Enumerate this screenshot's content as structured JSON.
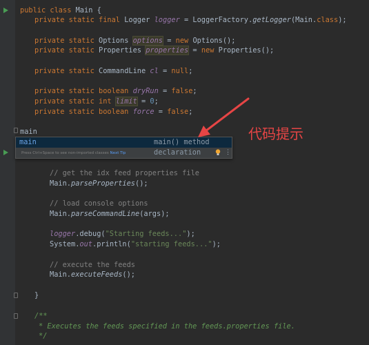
{
  "code": {
    "class_decl": {
      "kw": "public class ",
      "name": "Main {"
    },
    "logger": {
      "kw": "private static final ",
      "type": "Logger ",
      "field": "logger",
      "rest1": " = LoggerFactory.",
      "method": "getLogger",
      "rest2": "(Main.",
      "kw2": "class",
      "rest3": ");"
    },
    "options": {
      "kw": "private static ",
      "type": "Options ",
      "field": "options",
      "rest1": " = ",
      "kw2": "new ",
      "rest2": "Options();"
    },
    "properties": {
      "kw": "private static ",
      "type": "Properties ",
      "field": "properties",
      "rest1": " = ",
      "kw2": "new ",
      "rest2": "Properties();"
    },
    "cmdline": {
      "kw": "private static ",
      "type": "CommandLine ",
      "field": "cl",
      "rest1": " = ",
      "kw2": "null",
      "rest2": ";"
    },
    "dryrun": {
      "kw": "private static boolean ",
      "field": "dryRun",
      "rest1": " = ",
      "kw2": "false",
      "rest2": ";"
    },
    "limit": {
      "kw": "private static int ",
      "field": "limit",
      "rest1": " = ",
      "num": "0",
      "rest2": ";"
    },
    "force": {
      "kw": "private static boolean ",
      "field": "force",
      "rest1": " = ",
      "kw2": "false",
      "rest2": ";"
    },
    "typed": "main",
    "comment1": "// get the idx feed properties file",
    "call1": {
      "obj": "Main.",
      "method": "parseProperties",
      "rest": "();"
    },
    "comment2": "// load console options",
    "call2": {
      "obj": "Main.",
      "method": "parseCommandLine",
      "rest": "(args);"
    },
    "debug": {
      "field": "logger",
      "rest1": ".debug(",
      "str": "\"Starting feeds...\"",
      "rest2": ");"
    },
    "println": {
      "obj": "System.",
      "field": "out",
      "rest1": ".println(",
      "str": "\"starting feeds...\"",
      "rest2": ");"
    },
    "comment3": "// execute the feeds",
    "call3": {
      "obj": "Main.",
      "method": "executeFeeds",
      "rest": "();"
    },
    "close_brace": "}",
    "doc_open": "/**",
    "doc_body": "* Executes the feeds specified in the feeds.properties file.",
    "doc_close": "*/"
  },
  "popup": {
    "item_name": "main",
    "item_desc": "main() method declaration",
    "hint_text": "Press Ctrl+Space to see non-imported classes",
    "next_tip": "Next Tip",
    "bulb_icon": "lightbulb-icon",
    "more_icon": "more-vertical-icon"
  },
  "annotation": {
    "text": "代码提示",
    "color": "#e64545"
  }
}
